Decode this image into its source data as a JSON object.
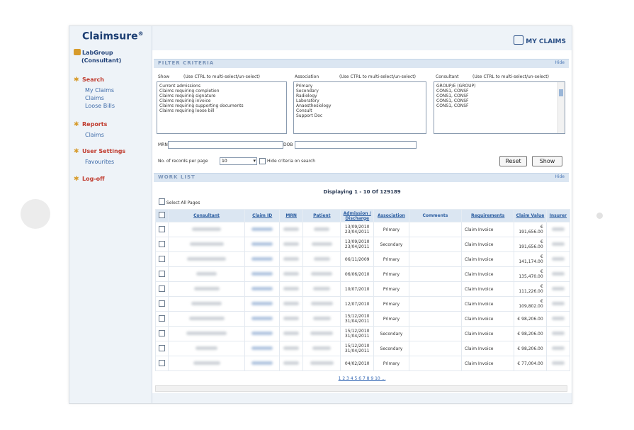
{
  "app": {
    "brand": "Claimsure",
    "brand_mark": "®",
    "group_name": "LabGroup",
    "group_role": "(Consultant)",
    "my_claims_label": "MY CLAIMS"
  },
  "sidebar": {
    "sections": [
      {
        "heading": "Search",
        "icon": "search-star-icon",
        "items": [
          "My Claims",
          "Claims",
          "Loose Bills"
        ]
      },
      {
        "heading": "Reports",
        "icon": "reports-star-icon",
        "items": [
          "Claims"
        ]
      },
      {
        "heading": "User Settings",
        "icon": "settings-star-icon",
        "items": [
          "Favourites"
        ]
      },
      {
        "heading": "Log-off",
        "icon": "logoff-star-icon",
        "items": []
      }
    ]
  },
  "filter": {
    "title": "FILTER CRITERIA",
    "hide_label": "Hide",
    "show_label": "Show",
    "show_hint": "(Use CTRL to multi-select/un-select)",
    "show_options": [
      "Current admissions",
      "Claims requiring completion",
      "Claims requiring signature",
      "Claims requiring invoice",
      "Claims requiring supporting documents",
      "Claims requiring loose bill"
    ],
    "association_label": "Association",
    "association_hint": "(Use CTRL to multi-select/un-select)",
    "association_options": [
      "Primary",
      "Secondary",
      "Radiology",
      "Laboratory",
      "Anaesthesiology",
      "Consult",
      "Support Doc"
    ],
    "consultant_label": "Consultant",
    "consultant_hint": "(Use CTRL to multi-select/un-select)",
    "consultant_options": [
      "GROUP/E (GROUP)",
      "CONS1, CONSF",
      "CONS1, CONSF",
      "CONS1, CONSF",
      "CONS1, CONSF"
    ],
    "mrn_label": "MRN",
    "dob_label": "DOB",
    "records_label": "No. of records per page",
    "records_value": "10",
    "hide_criteria_label": "Hide criteria on search",
    "reset_label": "Reset",
    "show_button_label": "Show"
  },
  "worklist": {
    "title": "WORK LIST",
    "hide_label": "Hide",
    "displaying": "Displaying 1 - 10 Of 129189",
    "select_all_label": "Select All Pages",
    "columns": [
      "Consultant",
      "Claim ID",
      "MRN",
      "Patient",
      "Admission / Discharge",
      "Association",
      "Comments",
      "Requirements",
      "Claim Value",
      "Insurer"
    ],
    "rows": [
      {
        "dates": "13/09/2010 23/04/2011",
        "association": "Primary",
        "requirements": "Claim Invoice",
        "value": "€ 191,656.00"
      },
      {
        "dates": "13/09/2010 23/04/2011",
        "association": "Secondary",
        "requirements": "Claim Invoice",
        "value": "€ 191,656.00"
      },
      {
        "dates": "06/11/2009",
        "association": "Primary",
        "requirements": "Claim Invoice",
        "value": "€ 141,174.00"
      },
      {
        "dates": "06/06/2010",
        "association": "Primary",
        "requirements": "Claim Invoice",
        "value": "€ 135,470.00"
      },
      {
        "dates": "10/07/2010",
        "association": "Primary",
        "requirements": "Claim Invoice",
        "value": "€ 111,226.00"
      },
      {
        "dates": "12/07/2010",
        "association": "Primary",
        "requirements": "Claim Invoice",
        "value": "€ 109,802.00"
      },
      {
        "dates": "15/12/2010 31/04/2011",
        "association": "Primary",
        "requirements": "Claim Invoice",
        "value": "€ 98,206.00"
      },
      {
        "dates": "15/12/2010 31/04/2011",
        "association": "Secondary",
        "requirements": "Claim Invoice",
        "value": "€ 98,206.00"
      },
      {
        "dates": "15/12/2010 31/04/2011",
        "association": "Secondary",
        "requirements": "Claim Invoice",
        "value": "€ 98,206.00"
      },
      {
        "dates": "04/02/2010",
        "association": "Primary",
        "requirements": "Claim Invoice",
        "value": "€ 77,004.00"
      }
    ],
    "pager": "1 2 3 4 5 6 7 8 9 10 ..."
  },
  "colors": {
    "sidebar_bg": "#eef3f8",
    "section_bar": "#dbe6f2",
    "link": "#3d6aa8",
    "heading_red": "#c03b2e",
    "brand": "#1d3f73"
  }
}
